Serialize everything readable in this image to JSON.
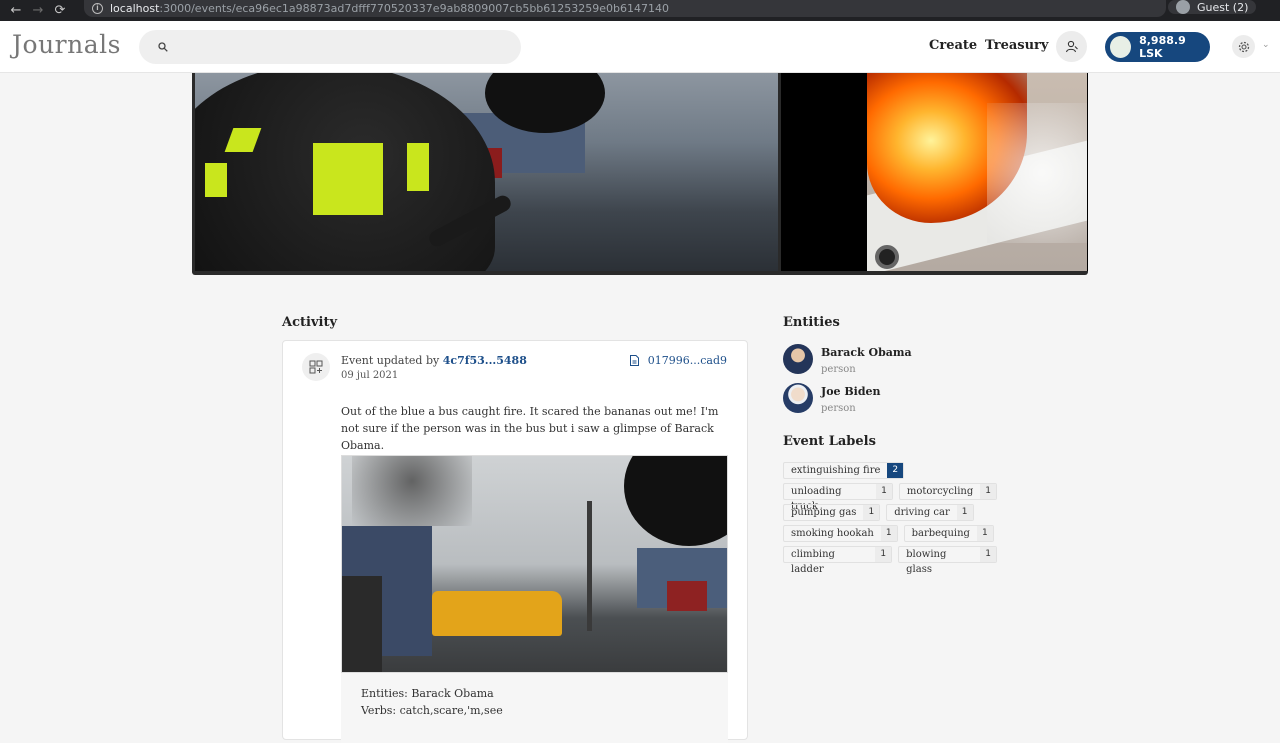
{
  "browser": {
    "url_host": "localhost",
    "url_rest": ":3000/events/eca96ec1a98873ad7dfff770520337e9ab8809007cb5bb61253259e0b6147140",
    "profile": "Guest (2)"
  },
  "header": {
    "logo": "Journals",
    "search_placeholder": "",
    "create_label": "Create",
    "treasury_label": "Treasury",
    "balance": "8,988.9 LSK"
  },
  "activity": {
    "title": "Activity",
    "event_prefix": "Event updated by",
    "author": "4c7f53...5488",
    "date": "09 jul 2021",
    "hash": "017996...cad9",
    "description": "Out of the blue a bus caught fire. It scared the bananas out me! I'm not sure if the person was in the bus but i saw a glimpse of Barack Obama.",
    "caption_entities": "Entities: Barack Obama",
    "caption_verbs": "Verbs: catch,scare,'m,see"
  },
  "entities": {
    "title": "Entities",
    "items": [
      {
        "name": "Barack Obama",
        "type": "person"
      },
      {
        "name": "Joe Biden",
        "type": "person"
      }
    ]
  },
  "event_labels": {
    "title": "Event Labels",
    "items": [
      {
        "label": "extinguishing fire",
        "count": "2"
      },
      {
        "label": "unloading truck",
        "count": "1"
      },
      {
        "label": "motorcycling",
        "count": "1"
      },
      {
        "label": "pumping gas",
        "count": "1"
      },
      {
        "label": "driving car",
        "count": "1"
      },
      {
        "label": "smoking hookah",
        "count": "1"
      },
      {
        "label": "barbequing",
        "count": "1"
      },
      {
        "label": "climbing ladder",
        "count": "1"
      },
      {
        "label": "blowing glass",
        "count": "1"
      }
    ]
  },
  "colors": {
    "accent": "#16477e",
    "link": "#1d4f8a"
  }
}
